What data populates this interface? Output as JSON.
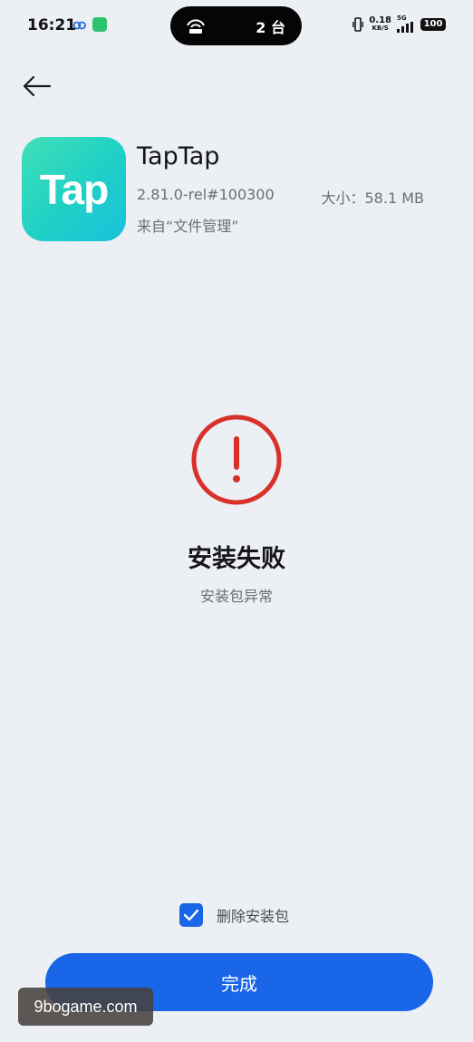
{
  "status_bar": {
    "time": "16:21",
    "island_text": "2 台",
    "net_speed": "0.18",
    "net_unit": "KB/S",
    "network_type": "5G",
    "battery": "100"
  },
  "app": {
    "name": "TapTap",
    "icon_text": "Tap",
    "version": "2.81.0-rel#100300",
    "size": "大小：58.1 MB",
    "source": "来自“文件管理”"
  },
  "result": {
    "title": "安装失败",
    "subtitle": "安装包异常",
    "icon": "error-circle-icon",
    "icon_color": "#d8312a"
  },
  "delete_package": {
    "label": "删除安装包",
    "checked": true
  },
  "done_button": {
    "label": "完成"
  },
  "watermark": "9bogame.com",
  "colors": {
    "accent": "#1a66e8",
    "background": "#eceff4",
    "error": "#d8312a"
  }
}
